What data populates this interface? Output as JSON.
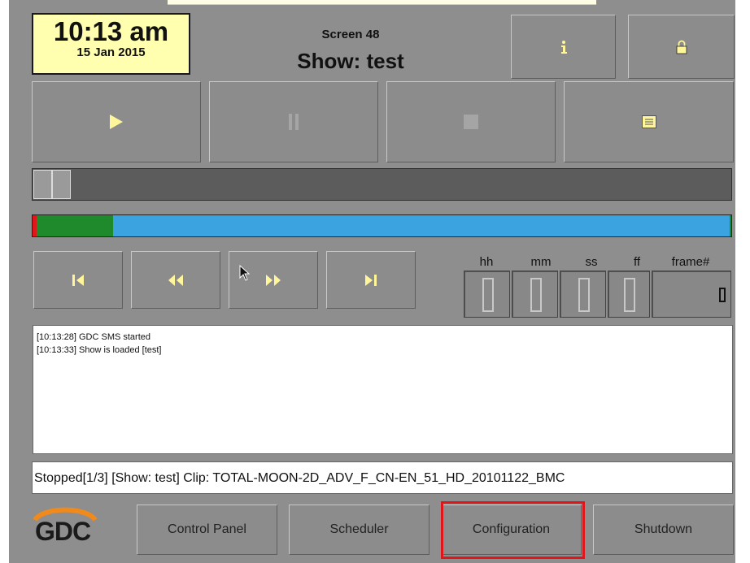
{
  "clock": {
    "time": "10:13 am",
    "date": "15 Jan 2015"
  },
  "header": {
    "screen": "Screen 48",
    "show": "Show: test"
  },
  "toolbar": {
    "info_icon": "info-icon",
    "lock_icon": "lock-icon"
  },
  "transport": {
    "play_icon": "play-icon",
    "pause_icon": "pause-icon",
    "stop_icon": "stop-icon",
    "playlist_icon": "playlist-icon"
  },
  "progress": {
    "played_fraction": 0.11
  },
  "navigation": {
    "skip_start_icon": "skip-to-start-icon",
    "rewind_icon": "rewind-icon",
    "fast_forward_icon": "fast-forward-icon",
    "skip_end_icon": "skip-to-end-icon"
  },
  "timecode": {
    "headers": [
      "hh",
      "mm",
      "ss",
      "ff",
      "frame#"
    ],
    "values": [
      "0",
      "0",
      "0",
      "0",
      "0"
    ]
  },
  "log": {
    "lines": [
      "[10:13:28] GDC SMS started",
      "[10:13:33] Show is loaded [test]"
    ]
  },
  "status": "Stopped[1/3] [Show: test] Clip: TOTAL-MOON-2D_ADV_F_CN-EN_51_HD_20101122_BMC",
  "footer": {
    "logo": "GDC",
    "buttons": [
      "Control Panel",
      "Scheduler",
      "Configuration",
      "Shutdown"
    ],
    "highlighted": "Configuration"
  },
  "colors": {
    "clock_bg": "#ffffaf",
    "progress_played": "#1f8a2c",
    "progress_remaining": "#3aa3e0",
    "logo_orange": "#f08a1c",
    "highlight": "#e0161b"
  }
}
